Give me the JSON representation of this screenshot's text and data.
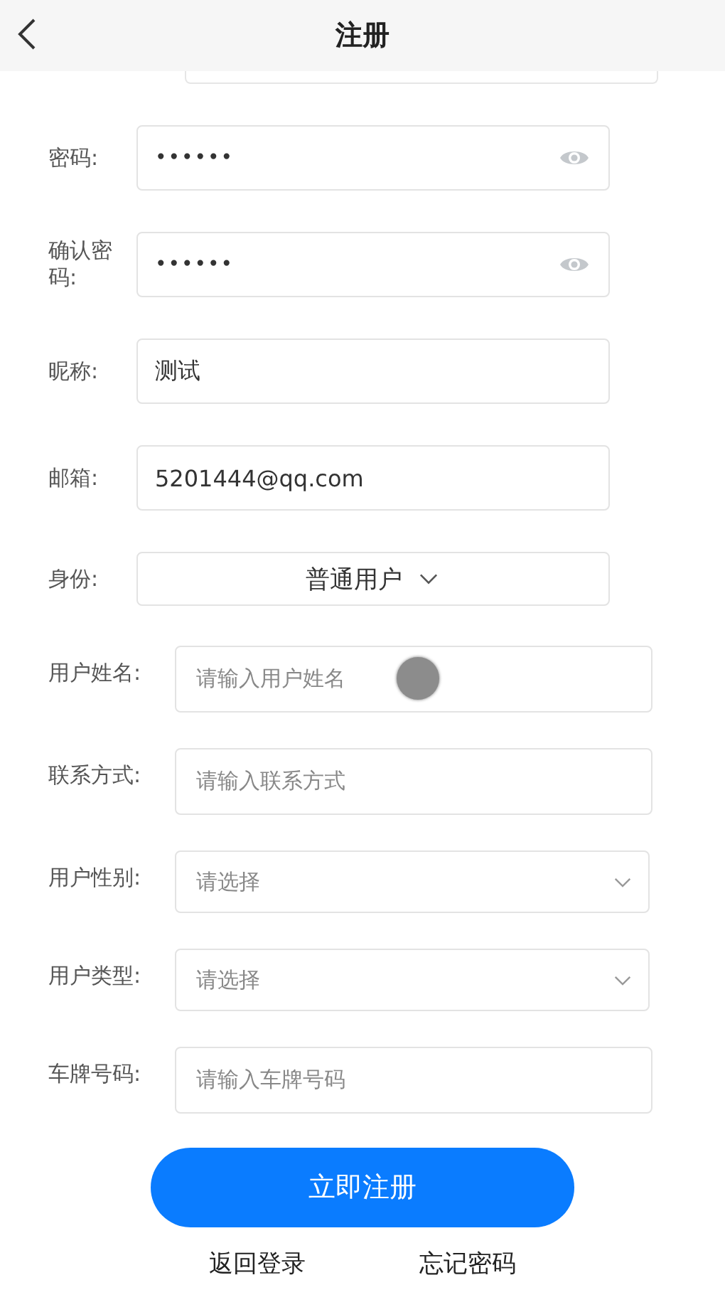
{
  "header": {
    "title": "注册"
  },
  "fields_primary": [
    {
      "label": "密码:",
      "kind": "password",
      "value": "••••••"
    },
    {
      "label": "确认密码:",
      "kind": "password",
      "value": "••••••"
    },
    {
      "label": "昵称:",
      "kind": "text",
      "value": "测试"
    },
    {
      "label": "邮箱:",
      "kind": "text",
      "value": "5201444@qq.com"
    },
    {
      "label": "身份:",
      "kind": "picker",
      "value": "普通用户"
    }
  ],
  "fields_secondary": [
    {
      "label": "用户姓名:",
      "kind": "input",
      "placeholder": "请输入用户姓名"
    },
    {
      "label": "联系方式:",
      "kind": "input",
      "placeholder": "请输入联系方式"
    },
    {
      "label": "用户性别:",
      "kind": "select",
      "placeholder": "请选择"
    },
    {
      "label": "用户类型:",
      "kind": "select",
      "placeholder": "请选择"
    },
    {
      "label": "车牌号码:",
      "kind": "input",
      "placeholder": "请输入车牌号码"
    }
  ],
  "submit_button": "立即注册",
  "links": [
    "返回登录",
    "忘记密码"
  ]
}
